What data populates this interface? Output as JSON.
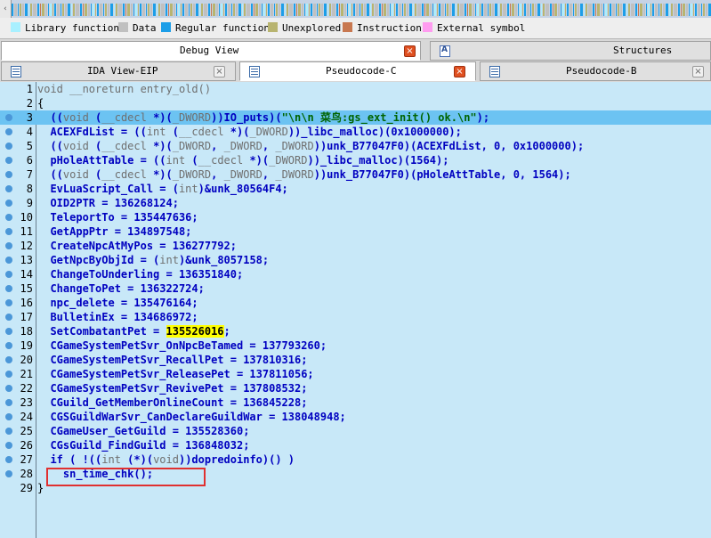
{
  "legend": [
    {
      "label": "Library function",
      "color": "#a8f0ff"
    },
    {
      "label": "Data",
      "color": "#c0c0c0"
    },
    {
      "label": "Regular function",
      "color": "#1c9ee8"
    },
    {
      "label": "Unexplored",
      "color": "#b8b470"
    },
    {
      "label": "Instruction",
      "color": "#c87850"
    },
    {
      "label": "External symbol",
      "color": "#ff9cf0"
    }
  ],
  "tabs_top": [
    {
      "label": "Debug View",
      "active": true
    },
    {
      "label": "Structures",
      "active": false
    }
  ],
  "tabs_bottom": [
    {
      "label": "IDA View-EIP",
      "active": false
    },
    {
      "label": "Pseudocode-C",
      "active": true
    },
    {
      "label": "Pseudocode-B",
      "active": false
    }
  ],
  "code_lines": [
    {
      "num": "1",
      "segs": [
        [
          "kw",
          "void __noreturn entry_old()"
        ]
      ]
    },
    {
      "num": "2",
      "segs": [
        [
          "pl",
          "{"
        ]
      ]
    },
    {
      "num": "3",
      "hl": true,
      "segs": [
        [
          "fn",
          "  (("
        ],
        [
          "kw",
          "void"
        ],
        [
          "fn",
          " ("
        ],
        [
          "kw",
          "__cdecl"
        ],
        [
          "fn",
          " *)("
        ],
        [
          "kw",
          "_DWORD"
        ],
        [
          "fn",
          "))IO_puts)("
        ],
        [
          "str",
          "\"\\n\\n 菜鸟:gs_ext_init() ok.\\n\""
        ],
        [
          "fn",
          ");"
        ]
      ]
    },
    {
      "num": "4",
      "segs": [
        [
          "fn",
          "  ACEXFdList = (("
        ],
        [
          "kw",
          "int"
        ],
        [
          "fn",
          " ("
        ],
        [
          "kw",
          "__cdecl"
        ],
        [
          "fn",
          " *)("
        ],
        [
          "kw",
          "_DWORD"
        ],
        [
          "fn",
          "))_libc_malloc)(0x1000000);"
        ]
      ]
    },
    {
      "num": "5",
      "segs": [
        [
          "fn",
          "  (("
        ],
        [
          "kw",
          "void"
        ],
        [
          "fn",
          " ("
        ],
        [
          "kw",
          "__cdecl"
        ],
        [
          "fn",
          " *)("
        ],
        [
          "kw",
          "_DWORD"
        ],
        [
          "fn",
          ", "
        ],
        [
          "kw",
          "_DWORD"
        ],
        [
          "fn",
          ", "
        ],
        [
          "kw",
          "_DWORD"
        ],
        [
          "fn",
          "))unk_B77047F0)(ACEXFdList, 0, 0x1000000);"
        ]
      ]
    },
    {
      "num": "6",
      "segs": [
        [
          "fn",
          "  pHoleAttTable = (("
        ],
        [
          "kw",
          "int"
        ],
        [
          "fn",
          " ("
        ],
        [
          "kw",
          "__cdecl"
        ],
        [
          "fn",
          " *)("
        ],
        [
          "kw",
          "_DWORD"
        ],
        [
          "fn",
          "))_libc_malloc)(1564);"
        ]
      ]
    },
    {
      "num": "7",
      "segs": [
        [
          "fn",
          "  (("
        ],
        [
          "kw",
          "void"
        ],
        [
          "fn",
          " ("
        ],
        [
          "kw",
          "__cdecl"
        ],
        [
          "fn",
          " *)("
        ],
        [
          "kw",
          "_DWORD"
        ],
        [
          "fn",
          ", "
        ],
        [
          "kw",
          "_DWORD"
        ],
        [
          "fn",
          ", "
        ],
        [
          "kw",
          "_DWORD"
        ],
        [
          "fn",
          "))unk_B77047F0)(pHoleAttTable, 0, 1564);"
        ]
      ]
    },
    {
      "num": "8",
      "segs": [
        [
          "fn",
          "  EvLuaScript_Call = ("
        ],
        [
          "kw",
          "int"
        ],
        [
          "fn",
          ")&unk_80564F4;"
        ]
      ]
    },
    {
      "num": "9",
      "segs": [
        [
          "fn",
          "  OID2PTR = 136268124;"
        ]
      ]
    },
    {
      "num": "10",
      "segs": [
        [
          "fn",
          "  TeleportTo = 135447636;"
        ]
      ]
    },
    {
      "num": "11",
      "segs": [
        [
          "fn",
          "  GetAppPtr = 134897548;"
        ]
      ]
    },
    {
      "num": "12",
      "segs": [
        [
          "fn",
          "  CreateNpcAtMyPos = 136277792;"
        ]
      ]
    },
    {
      "num": "13",
      "segs": [
        [
          "fn",
          "  GetNpcByObjId = ("
        ],
        [
          "kw",
          "int"
        ],
        [
          "fn",
          ")&unk_8057158;"
        ]
      ]
    },
    {
      "num": "14",
      "segs": [
        [
          "fn",
          "  ChangeToUnderling = 136351840;"
        ]
      ]
    },
    {
      "num": "15",
      "segs": [
        [
          "fn",
          "  ChangeToPet = 136322724;"
        ]
      ]
    },
    {
      "num": "16",
      "segs": [
        [
          "fn",
          "  npc_delete = 135476164;"
        ]
      ]
    },
    {
      "num": "17",
      "segs": [
        [
          "fn",
          "  BulletinEx = 134686972;"
        ]
      ]
    },
    {
      "num": "18",
      "segs": [
        [
          "fn",
          "  SetCombatantPet = "
        ],
        [
          "yel",
          "135526016"
        ],
        [
          "fn",
          ";"
        ]
      ]
    },
    {
      "num": "19",
      "segs": [
        [
          "fn",
          "  CGameSystemPetSvr_OnNpcBeTamed = 137793260;"
        ]
      ]
    },
    {
      "num": "20",
      "segs": [
        [
          "fn",
          "  CGameSystemPetSvr_RecallPet = 137810316;"
        ]
      ]
    },
    {
      "num": "21",
      "segs": [
        [
          "fn",
          "  CGameSystemPetSvr_ReleasePet = 137811056;"
        ]
      ]
    },
    {
      "num": "22",
      "segs": [
        [
          "fn",
          "  CGameSystemPetSvr_RevivePet = 137808532;"
        ]
      ]
    },
    {
      "num": "23",
      "segs": [
        [
          "fn",
          "  CGuild_GetMemberOnlineCount = 136845228;"
        ]
      ]
    },
    {
      "num": "24",
      "segs": [
        [
          "fn",
          "  CGSGuildWarSvr_CanDeclareGuildWar = 138048948;"
        ]
      ]
    },
    {
      "num": "25",
      "segs": [
        [
          "fn",
          "  CGameUser_GetGuild = 135528360;"
        ]
      ]
    },
    {
      "num": "26",
      "segs": [
        [
          "fn",
          "  CGsGuild_FindGuild = 136848032;"
        ]
      ]
    },
    {
      "num": "27",
      "segs": [
        [
          "fn",
          "  if ( !(("
        ],
        [
          "kw",
          "int"
        ],
        [
          "fn",
          " (*)("
        ],
        [
          "kw",
          "void"
        ],
        [
          "fn",
          "))dopredoinfo)() )"
        ]
      ]
    },
    {
      "num": "28",
      "segs": [
        [
          "fn",
          "    sn_time_chk();"
        ]
      ]
    },
    {
      "num": "29",
      "segs": [
        [
          "pl",
          "}"
        ]
      ]
    }
  ],
  "navbar_colors": {
    "regular": "#1c9ee8",
    "data": "#c0c0c0",
    "unexplored": "#b8b470",
    "library": "#a8f0ff",
    "instruction": "#c87850"
  }
}
